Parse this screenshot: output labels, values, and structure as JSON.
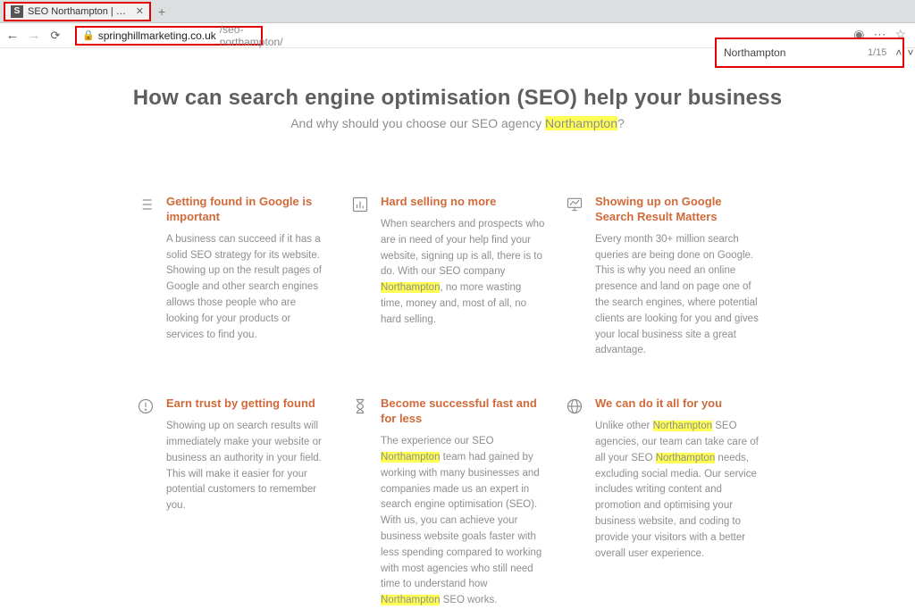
{
  "browser": {
    "tab_title": "SEO Northampton | Search Engi",
    "url_domain": "springhillmarketing.co.uk",
    "url_path": "/seo-northampton/"
  },
  "find": {
    "query": "Northampton",
    "count": "1/15"
  },
  "headline": {
    "title": "How can search engine optimisation (SEO) help your business"
  },
  "subhead": {
    "pre": "And why should you choose our SEO agency ",
    "hl": "Northampton",
    "post": "?"
  },
  "cards": {
    "c1": {
      "title": "Getting found in Google is important",
      "body": "A business can succeed if it has a solid SEO strategy for its website. Showing up on the result pages of Google and other search engines allows those people who are looking for your products or services to find you."
    },
    "c2": {
      "title": "Hard selling no more",
      "body_a": "When searchers and prospects who are in need of your help find your website, signing up is all, there is to do. With our SEO company ",
      "hl": "Northampton",
      "body_b": ", no more wasting time, money and, most of all, no hard selling."
    },
    "c3": {
      "title": "Showing up on Google Search Result Matters",
      "body": "Every month 30+ million search queries are being done on Google. This is why you need an online presence and land on page one of the search engines, where potential clients are looking for you and gives your local business site a great advantage."
    },
    "c4": {
      "title": "Earn trust by getting found",
      "body": "Showing up on search results will immediately make your website or business an authority in your field. This will make it easier for your potential customers to remember you."
    },
    "c5": {
      "title": "Become successful fast and for less",
      "body_a": "The experience our SEO ",
      "hl1": "Northampton",
      "body_b": " team had gained by working with many businesses and companies made us an expert in search engine optimisation (SEO).  With us, you can achieve your business website goals faster with less spending compared to working with most agencies who still need time to understand how ",
      "hl2": "Northampton",
      "body_c": " SEO works."
    },
    "c6": {
      "title": "We can do it all for you",
      "body_a": "Unlike other ",
      "hl1": "Northampton",
      "body_b": " SEO agencies, our team can take care of all your SEO ",
      "hl2": "Northampton",
      "body_c": " needs, excluding social media. Our service includes writing content and promotion and optimising your business website, and coding to provide your visitors with a better overall user experience."
    }
  }
}
